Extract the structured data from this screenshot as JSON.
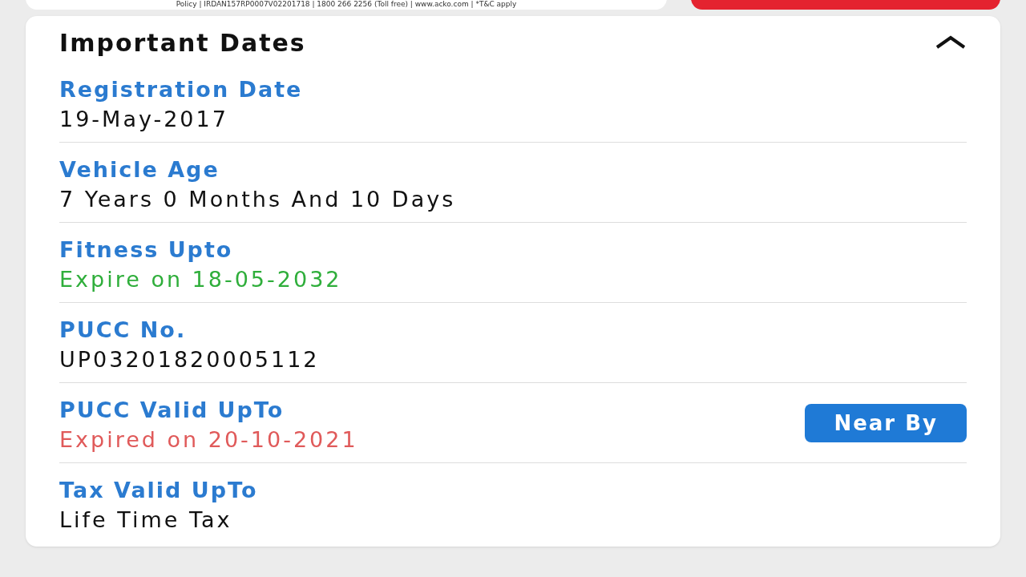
{
  "banner": {
    "footnote": "Policy | IRDAN157RP0007V02201718 | 1800 266 2256 (Toll free) | www.acko.com | *T&C apply"
  },
  "card": {
    "title": "Important Dates",
    "expanded": true,
    "rows": [
      {
        "label": "Registration Date",
        "value": "19-May-2017",
        "color": "#111111"
      },
      {
        "label": "Vehicle Age",
        "value": "7 Years 0 Months And 10 Days",
        "color": "#111111"
      },
      {
        "label": "Fitness Upto",
        "value": "Expire on 18-05-2032",
        "color": "#2fae3b"
      },
      {
        "label": "PUCC No.",
        "value": "UP03201820005112",
        "color": "#111111"
      },
      {
        "label": "PUCC Valid UpTo",
        "value": "Expired on 20-10-2021",
        "color": "#e05a5a",
        "button": "Near By"
      },
      {
        "label": "Tax Valid UpTo",
        "value": "Life Time Tax",
        "color": "#111111"
      }
    ]
  }
}
